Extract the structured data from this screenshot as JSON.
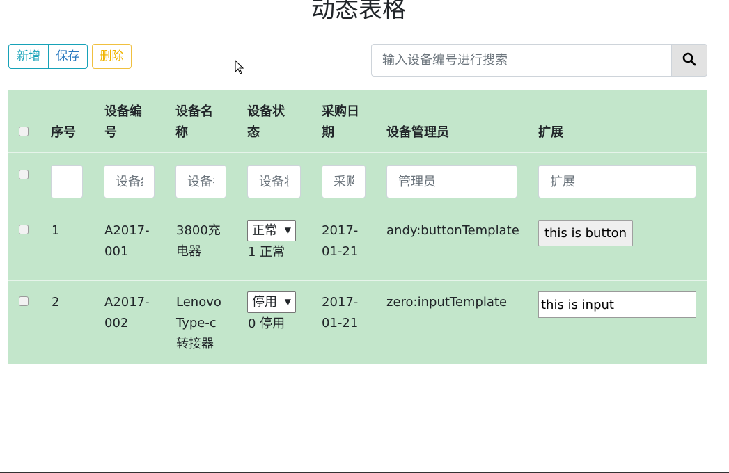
{
  "page": {
    "title": "动态表格"
  },
  "toolbar": {
    "add_label": "新增",
    "save_label": "保存",
    "delete_label": "删除"
  },
  "search": {
    "placeholder": "输入设备编号进行搜索",
    "icon": "search-icon"
  },
  "table": {
    "headers": {
      "index": "序号",
      "code": [
        "设备编",
        "号"
      ],
      "name": [
        "设备名",
        "称"
      ],
      "status": [
        "设备状",
        "态"
      ],
      "date": [
        "采购日",
        "期"
      ],
      "manager": "设备管理员",
      "ext": "扩展"
    },
    "filters": {
      "index": "",
      "code": "设备编号",
      "name": "设备名称",
      "status": "设备状态",
      "date": "采购日期",
      "manager": "管理员",
      "ext": "扩展"
    },
    "rows": [
      {
        "index": "1",
        "code": [
          "A2017-",
          "001"
        ],
        "name": [
          "3800充",
          "电器"
        ],
        "status_selected": "正常",
        "status_text": "1 正常",
        "date": [
          "2017-",
          "01-21"
        ],
        "manager": "andy:buttonTemplate",
        "ext_button": "this is button"
      },
      {
        "index": "2",
        "code": [
          "A2017-",
          "002"
        ],
        "name": [
          "Lenovo",
          "Type-c",
          "转接器"
        ],
        "status_selected": "停用",
        "status_text": "0 停用",
        "date": [
          "2017-",
          "01-21"
        ],
        "manager": "zero:inputTemplate",
        "ext_input": "this is input"
      }
    ]
  },
  "colors": {
    "row_bg": "#c3e6cb",
    "info": "#17a2b8",
    "warning": "#f0b400"
  }
}
